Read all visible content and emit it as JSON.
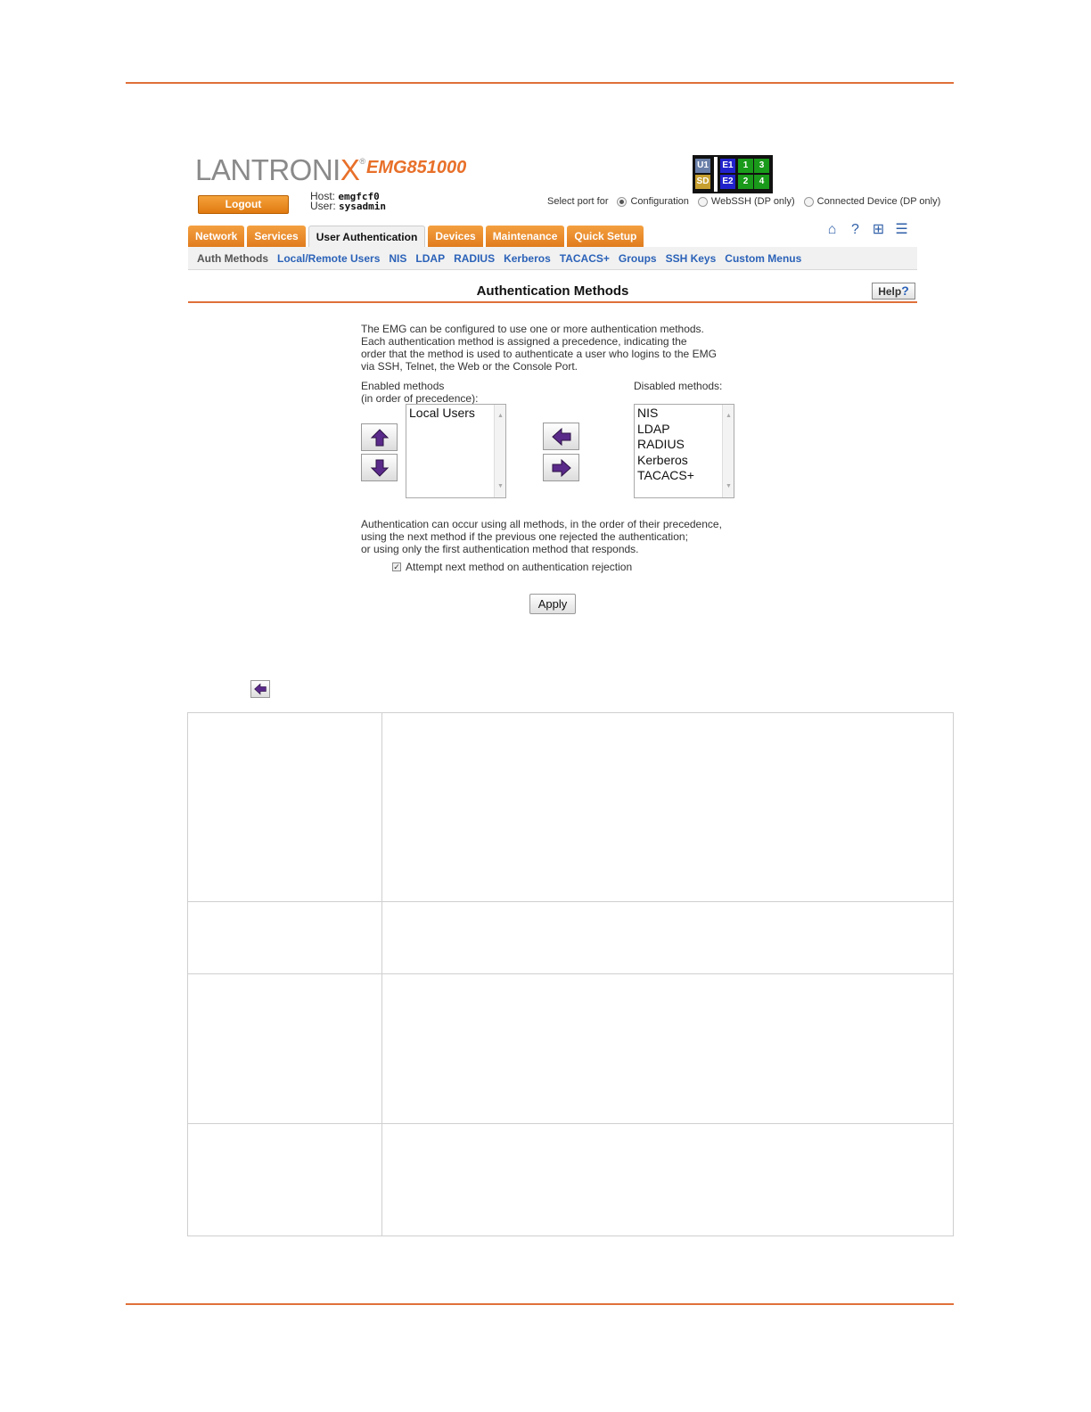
{
  "brand": {
    "logo_prefix": "LANTRONI",
    "logo_x": "X",
    "logo_reg": "®",
    "model": "EMG851000"
  },
  "session": {
    "logout_label": "Logout",
    "host_label": "Host:",
    "host_value": "emgfcf0",
    "user_label": "User:",
    "user_value": "sysadmin"
  },
  "port_status": {
    "cells": [
      {
        "label": "U1",
        "color": "#6a7fa8"
      },
      {
        "label": "SD",
        "color": "#c8a030"
      },
      {
        "label": "E1",
        "color": "#2222cc"
      },
      {
        "label": "E2",
        "color": "#2222cc"
      },
      {
        "label": "1",
        "color": "#1a9a1a"
      },
      {
        "label": "3",
        "color": "#1a9a1a"
      },
      {
        "label": "2",
        "color": "#1a9a1a"
      },
      {
        "label": "4",
        "color": "#1a9a1a"
      }
    ]
  },
  "select_port": {
    "label": "Select port for",
    "options": [
      {
        "label": "Configuration",
        "selected": true
      },
      {
        "label": "WebSSH (DP only)",
        "selected": false
      },
      {
        "label": "Connected Device (DP only)",
        "selected": false
      }
    ]
  },
  "tabs": [
    {
      "label": "Network",
      "active": false
    },
    {
      "label": "Services",
      "active": false
    },
    {
      "label": "User Authentication",
      "active": true
    },
    {
      "label": "Devices",
      "active": false
    },
    {
      "label": "Maintenance",
      "active": false
    },
    {
      "label": "Quick Setup",
      "active": false
    }
  ],
  "top_icons": [
    "home-icon",
    "help-icon",
    "network-icon",
    "log-icon"
  ],
  "subnav": [
    {
      "label": "Auth Methods",
      "current": true
    },
    {
      "label": "Local/Remote Users",
      "current": false
    },
    {
      "label": "NIS",
      "current": false
    },
    {
      "label": "LDAP",
      "current": false
    },
    {
      "label": "RADIUS",
      "current": false
    },
    {
      "label": "Kerberos",
      "current": false
    },
    {
      "label": "TACACS+",
      "current": false
    },
    {
      "label": "Groups",
      "current": false
    },
    {
      "label": "SSH Keys",
      "current": false
    },
    {
      "label": "Custom Menus",
      "current": false
    }
  ],
  "page": {
    "title": "Authentication Methods",
    "help_label": "Help",
    "help_q": "?",
    "intro_lines": [
      "The EMG can be configured to use one or more authentication methods.",
      "Each authentication method is assigned a precedence, indicating the",
      "order that the method is used to authenticate a user who logins to the EMG",
      "via SSH, Telnet, the Web or the Console Port."
    ],
    "enabled_label_1": "Enabled methods",
    "enabled_label_2": "(in order of precedence):",
    "disabled_label": "Disabled methods:",
    "enabled_methods": [
      "Local Users"
    ],
    "disabled_methods": [
      "NIS",
      "LDAP",
      "RADIUS",
      "Kerberos",
      "TACACS+"
    ],
    "info_lines": [
      "Authentication can occur using all methods, in the order of their precedence,",
      "using the next method if the previous one rejected the authentication;",
      "or using only the first authentication method that responds."
    ],
    "attempt_next_label": "Attempt next method on authentication rejection",
    "attempt_next_checked": true,
    "apply_label": "Apply"
  },
  "colors": {
    "accent": "#e0703a",
    "link": "#2b62b8",
    "arrow": "#5a2a8a"
  }
}
